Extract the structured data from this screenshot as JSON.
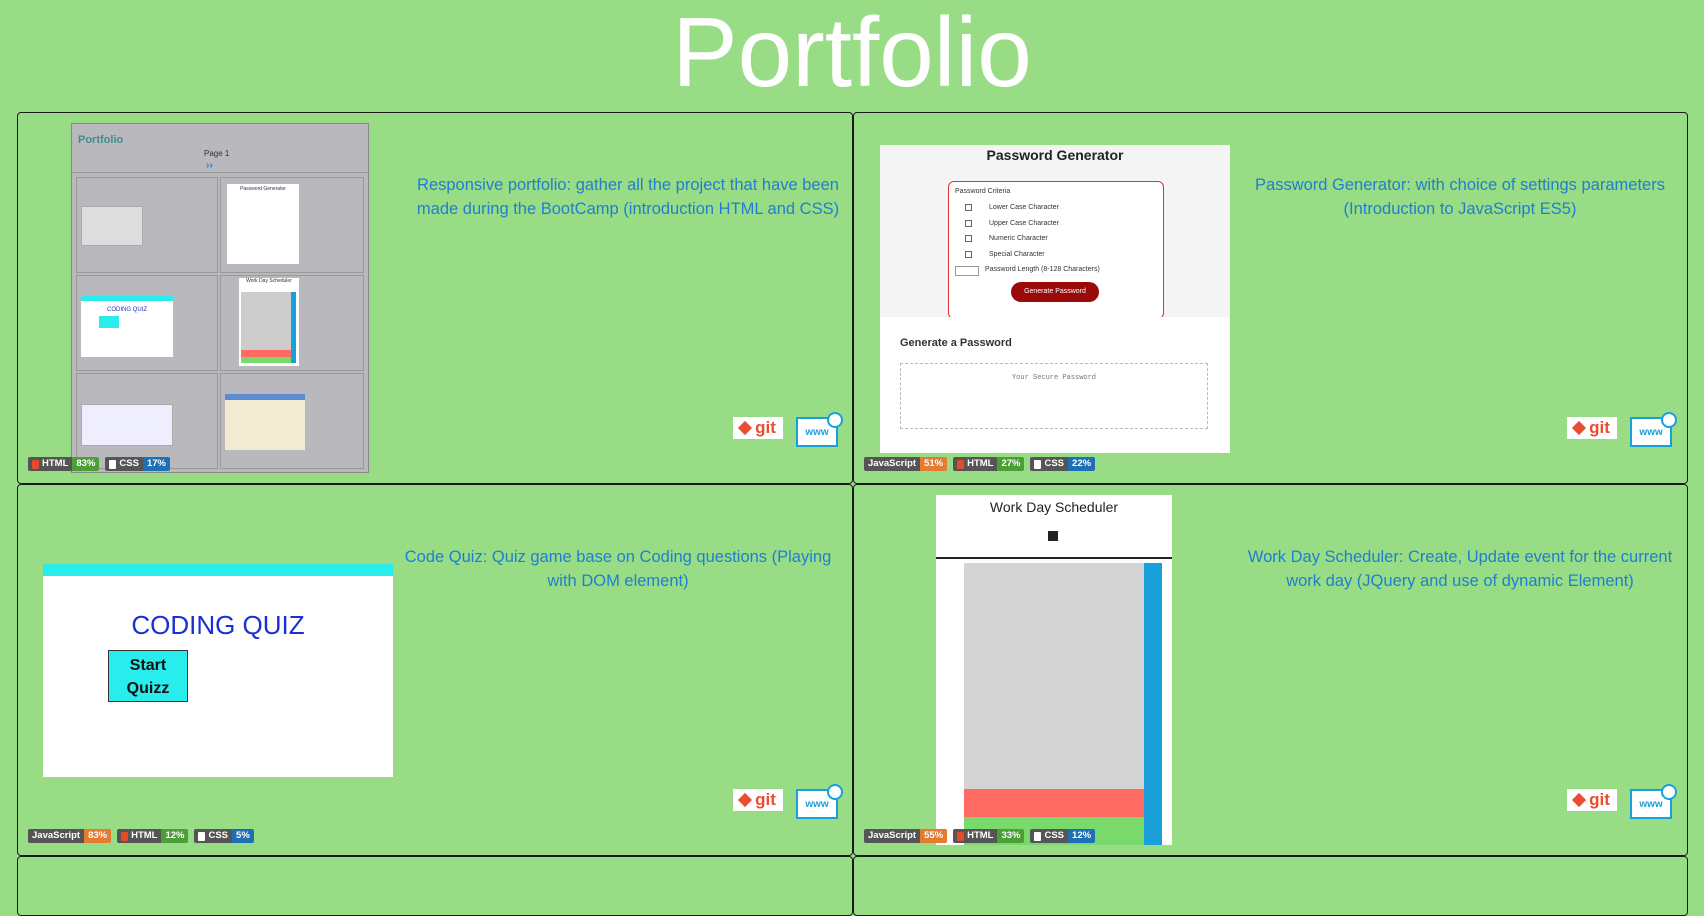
{
  "page": {
    "title": "Portfolio"
  },
  "cards": [
    {
      "id": "portfolio",
      "description": "Responsive portfolio: gather all the project that have been made during the BootCamp (introduction HTML and CSS)",
      "badges": [
        {
          "lang": "HTML",
          "pct": "83%"
        },
        {
          "lang": "CSS",
          "pct": "17%"
        }
      ],
      "git_label": "git",
      "www_label": "www",
      "preview": {
        "title": "Portfolio",
        "page_label": "Page 1",
        "tiles": [
          "Password Generator",
          "CODING QUIZ",
          "Work Day Scheduler",
          ""
        ]
      }
    },
    {
      "id": "password-generator",
      "description": "Password Generator: with choice of settings parameters (Introduction to JavaScript ES5)",
      "badges": [
        {
          "lang": "JavaScript",
          "pct": "51%"
        },
        {
          "lang": "HTML",
          "pct": "27%"
        },
        {
          "lang": "CSS",
          "pct": "22%"
        }
      ],
      "git_label": "git",
      "www_label": "www",
      "preview": {
        "title": "Password Generator",
        "criteria_label": "Password Criteria",
        "options": [
          "Lower Case Character",
          "Upper Case Character",
          "Numeric Character",
          "Special Character"
        ],
        "length_label": "Password Length (8-128 Characters)",
        "generate_button": "Generate Password",
        "section_title": "Generate a Password",
        "output_placeholder": "Your Secure Password"
      }
    },
    {
      "id": "code-quiz",
      "description": "Code Quiz: Quiz game base on Coding questions (Playing with DOM element)",
      "badges": [
        {
          "lang": "JavaScript",
          "pct": "83%"
        },
        {
          "lang": "HTML",
          "pct": "12%"
        },
        {
          "lang": "CSS",
          "pct": "5%"
        }
      ],
      "git_label": "git",
      "www_label": "www",
      "preview": {
        "title": "CODING QUIZ",
        "start_line1": "Start",
        "start_line2": "Quizz"
      }
    },
    {
      "id": "work-day-scheduler",
      "description": "Work Day Scheduler: Create, Update event for the current work day (JQuery and use of dynamic Element)",
      "badges": [
        {
          "lang": "JavaScript",
          "pct": "55%"
        },
        {
          "lang": "HTML",
          "pct": "33%"
        },
        {
          "lang": "CSS",
          "pct": "12%"
        }
      ],
      "git_label": "git",
      "www_label": "www",
      "preview": {
        "title": "Work Day Scheduler"
      }
    }
  ],
  "colors": {
    "background": "#98dd86",
    "link": "#1e7fd1",
    "git": "#e84e31",
    "www": "#1aa0d8"
  }
}
